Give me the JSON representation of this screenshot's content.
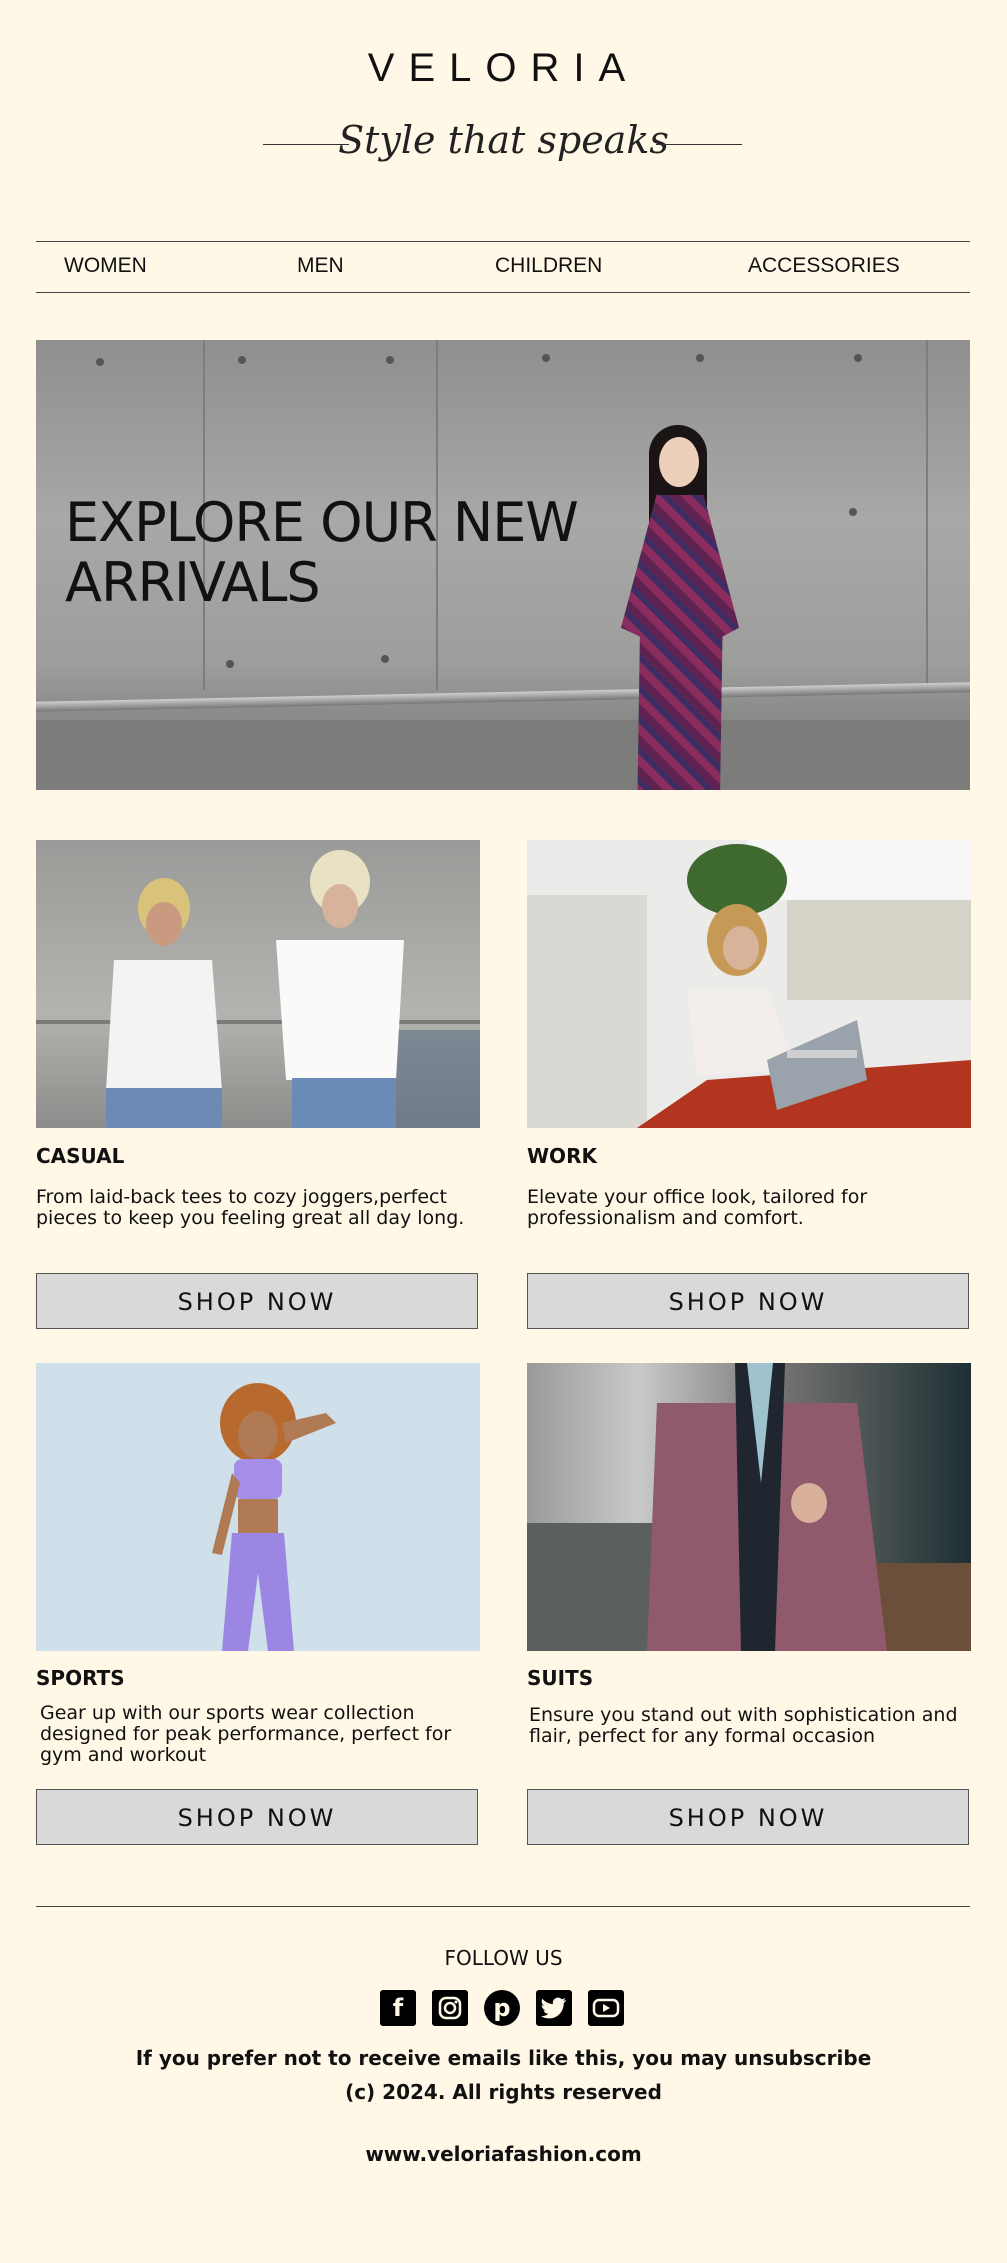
{
  "header": {
    "brand": "VELORIA",
    "tagline": "Style that speaks"
  },
  "nav": {
    "items": [
      {
        "label": "WOMEN"
      },
      {
        "label": "MEN"
      },
      {
        "label": "CHILDREN"
      },
      {
        "label": "ACCESSORIES"
      }
    ]
  },
  "hero": {
    "title_line1": "EXPLORE OUR NEW",
    "title_line2": "ARRIVALS"
  },
  "categories": [
    {
      "title": "CASUAL",
      "description": "From laid-back tees to cozy joggers,perfect pieces to keep you feeling great all day long.",
      "button": "SHOP NOW"
    },
    {
      "title": "WORK",
      "description": "Elevate your office look, tailored for professionalism and comfort.",
      "button": "SHOP NOW"
    },
    {
      "title": "SPORTS",
      "description": "Gear up with our sports wear collection designed for peak performance, perfect for gym and workout",
      "button": "SHOP NOW"
    },
    {
      "title": "SUITS",
      "description": "Ensure you stand out with sophistication and flair, perfect for any formal occasion",
      "button": "SHOP NOW"
    }
  ],
  "footer": {
    "follow_label": "FOLLOW US",
    "socials": [
      {
        "icon": "facebook-icon"
      },
      {
        "icon": "instagram-icon"
      },
      {
        "icon": "pinterest-icon"
      },
      {
        "icon": "twitter-icon"
      },
      {
        "icon": "youtube-icon"
      }
    ],
    "unsubscribe_text": "If you prefer not to receive emails like this, you may unsubscribe",
    "copyright": "(c) 2024. All rights reserved",
    "website": "www.veloriafashion.com"
  },
  "colors": {
    "background": "#fff8e7",
    "button": "#d9d9d9",
    "text": "#111111"
  }
}
